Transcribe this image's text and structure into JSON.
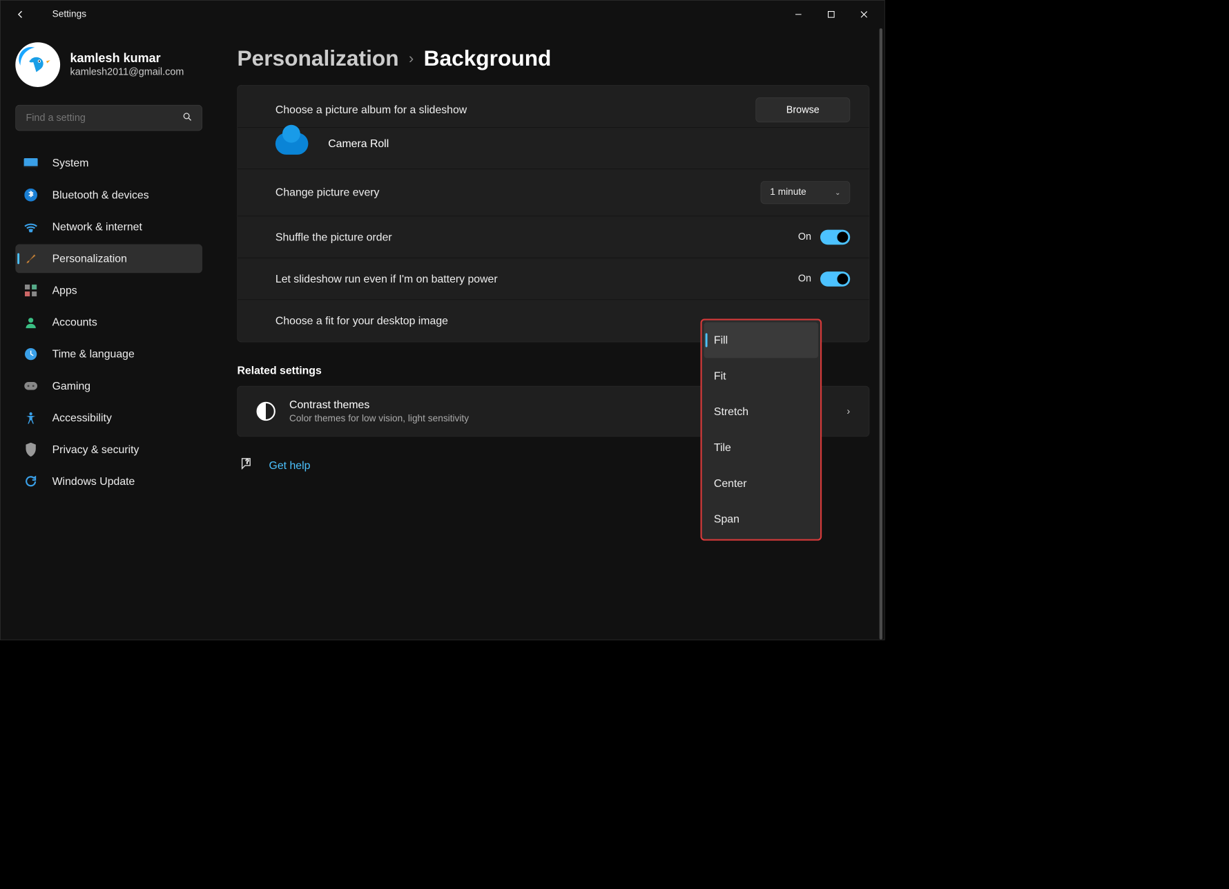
{
  "title": "Settings",
  "user": {
    "name": "kamlesh kumar",
    "email": "kamlesh2011@gmail.com"
  },
  "search": {
    "placeholder": "Find a setting"
  },
  "sidebar": {
    "items": [
      {
        "label": "System",
        "icon": "💻"
      },
      {
        "label": "Bluetooth & devices",
        "icon": "ᚼ"
      },
      {
        "label": "Network & internet",
        "icon": "📶"
      },
      {
        "label": "Personalization",
        "icon": "🖌"
      },
      {
        "label": "Apps",
        "icon": "▦"
      },
      {
        "label": "Accounts",
        "icon": "👤"
      },
      {
        "label": "Time & language",
        "icon": "🕒"
      },
      {
        "label": "Gaming",
        "icon": "🎮"
      },
      {
        "label": "Accessibility",
        "icon": "✲"
      },
      {
        "label": "Privacy & security",
        "icon": "🛡"
      },
      {
        "label": "Windows Update",
        "icon": "⟳"
      }
    ],
    "active": "Personalization"
  },
  "breadcrumb": {
    "parent": "Personalization",
    "current": "Background"
  },
  "panel": {
    "album_label": "Choose a picture album for a slideshow",
    "browse": "Browse",
    "album_name": "Camera Roll",
    "interval_label": "Change picture every",
    "interval_value": "1 minute",
    "shuffle_label": "Shuffle the picture order",
    "shuffle_state": "On",
    "battery_label": "Let slideshow run even if I'm on battery power",
    "battery_state": "On",
    "fit_label": "Choose a fit for your desktop image"
  },
  "related": {
    "heading": "Related settings",
    "contrast_title": "Contrast themes",
    "contrast_sub": "Color themes for low vision, light sensitivity"
  },
  "help": {
    "label": "Get help"
  },
  "fit_options": [
    "Fill",
    "Fit",
    "Stretch",
    "Tile",
    "Center",
    "Span"
  ],
  "fit_selected": "Fill"
}
